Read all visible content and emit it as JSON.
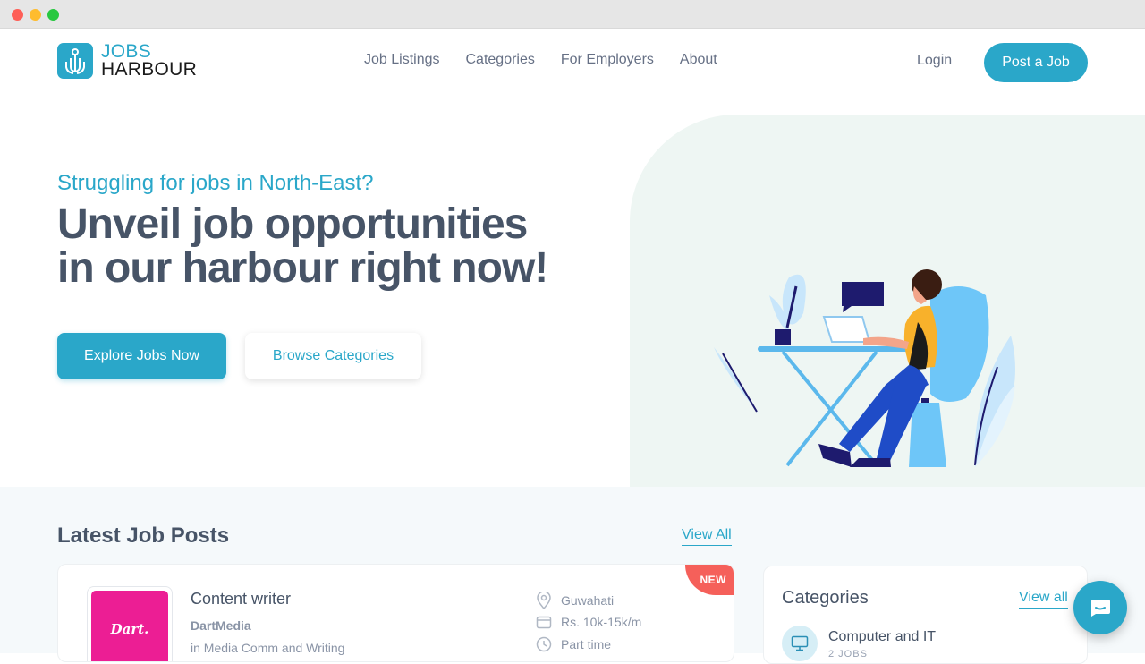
{
  "brand": {
    "line1": "JOBS",
    "line2": "HARBOUR",
    "accent": "#2aa7c9"
  },
  "nav": {
    "items": [
      "Job Listings",
      "Categories",
      "For Employers",
      "About"
    ],
    "login": "Login",
    "post_job": "Post a Job"
  },
  "hero": {
    "tagline": "Struggling for jobs in North-East?",
    "headline_line1": "Unveil job opportunities",
    "headline_line2": "in our harbour right now!",
    "primary_cta": "Explore Jobs Now",
    "secondary_cta": "Browse Categories"
  },
  "latest": {
    "title": "Latest Job Posts",
    "view_all": "View All",
    "jobs": [
      {
        "badge": "NEW",
        "logo_text": "Dart.",
        "title": "Content writer",
        "company": "DartMedia",
        "category": "in Media Comm and Writing",
        "location": "Guwahati",
        "salary": "Rs. 10k-15k/m",
        "type": "Part time"
      }
    ]
  },
  "categories": {
    "title": "Categories",
    "view_all": "View all",
    "items": [
      {
        "name": "Computer and IT",
        "count": "2 JOBS",
        "icon": "monitor-icon"
      }
    ]
  }
}
